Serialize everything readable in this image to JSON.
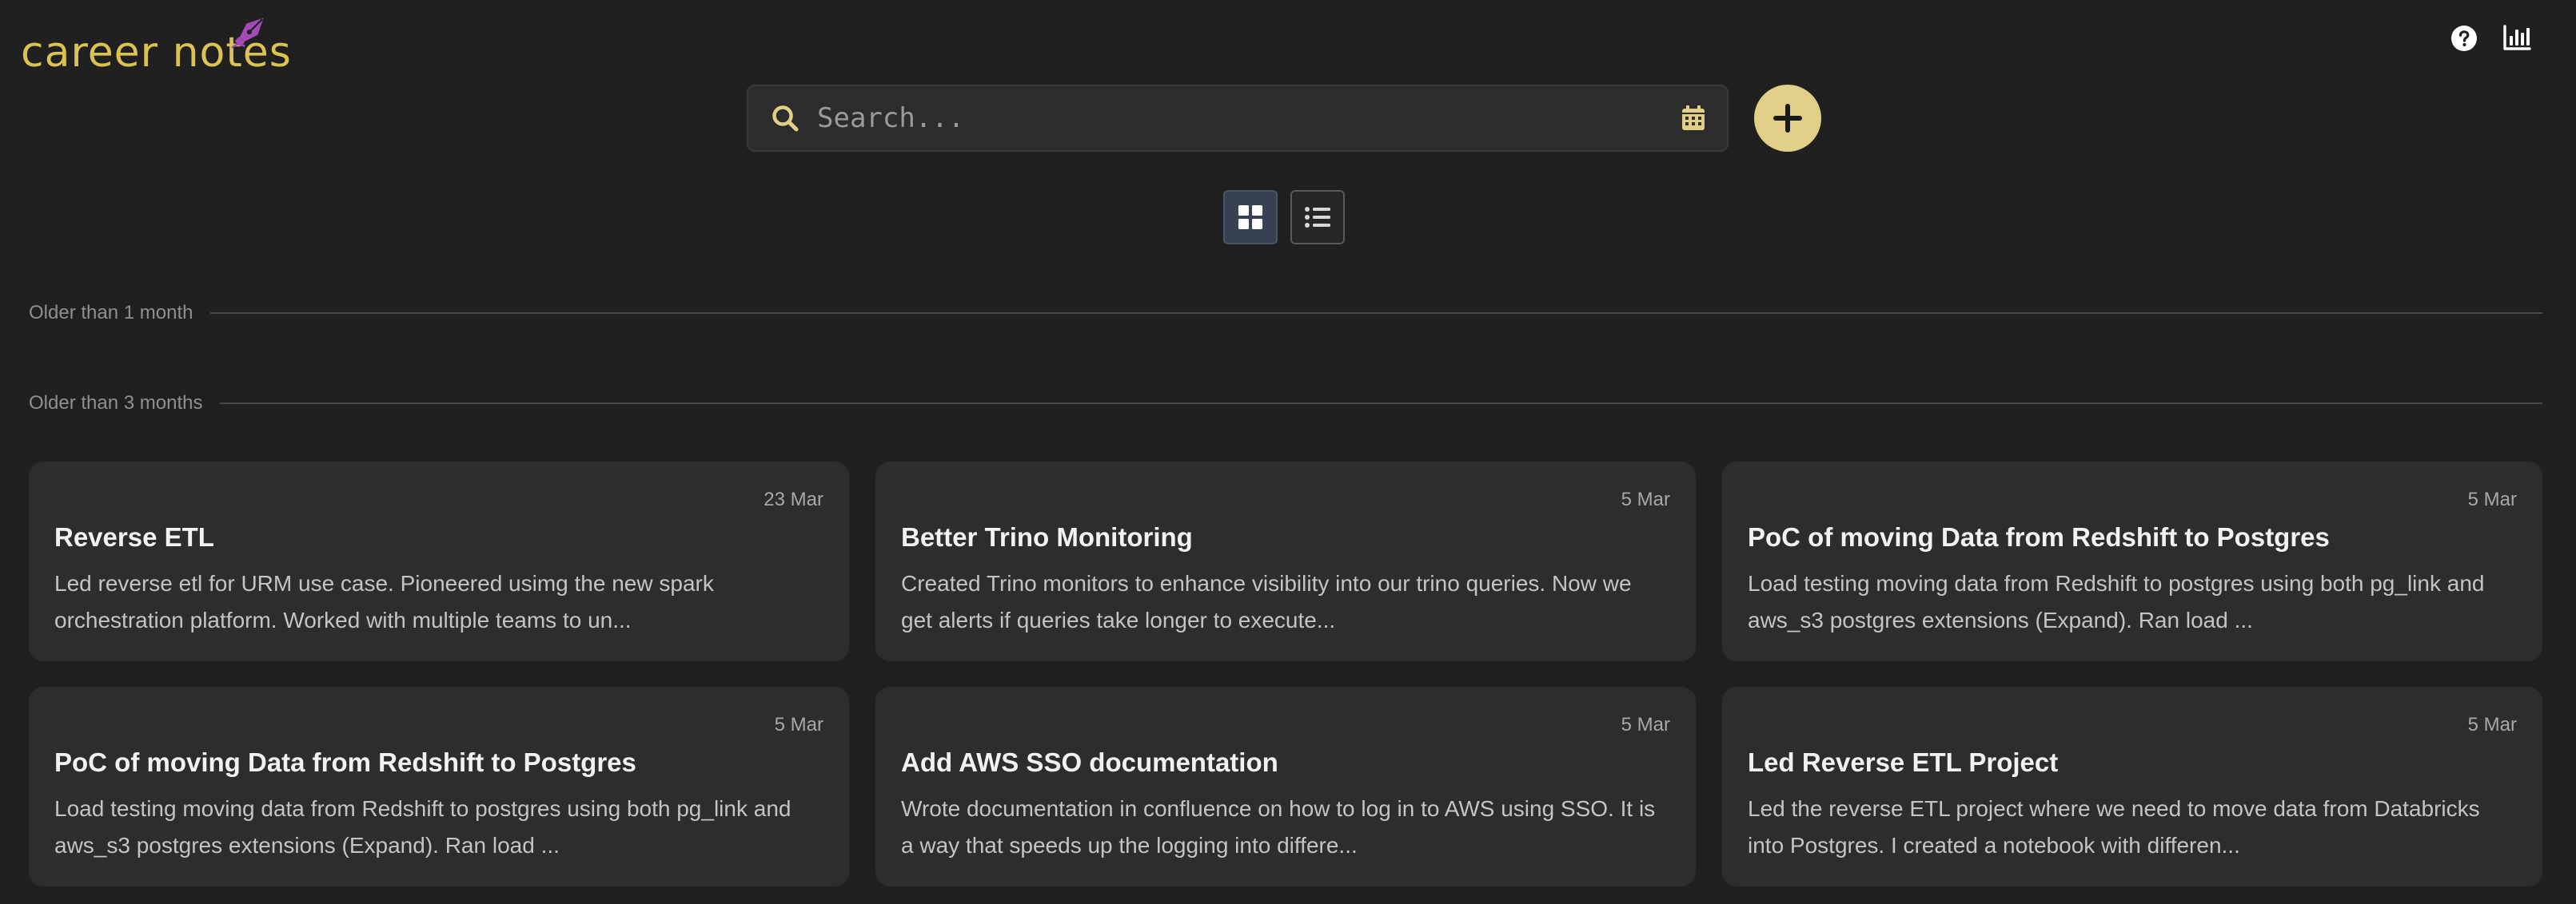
{
  "app": {
    "logo_text": "career notes",
    "accent_color": "#dcc253",
    "pen_color": "#a24bb5"
  },
  "header": {
    "icons": [
      "help-icon",
      "chart-bar-icon"
    ]
  },
  "search": {
    "placeholder": "Search...",
    "value": ""
  },
  "add_button": {
    "icon": "plus-icon",
    "color": "#e2cf87"
  },
  "view": {
    "selected": "grid",
    "options": [
      "grid",
      "list"
    ]
  },
  "sections": [
    {
      "label": "Older than 1 month",
      "notes": []
    },
    {
      "label": "Older than 3 months",
      "notes": [
        {
          "date": "23 Mar",
          "title": "Reverse ETL",
          "body": "Led reverse etl for URM use case. Pioneered usimg the new spark orchestration platform. Worked with multiple teams to un..."
        },
        {
          "date": "5 Mar",
          "title": "Better Trino Monitoring",
          "body": "Created Trino monitors to enhance visibility into our trino queries. Now we get alerts if queries take longer to execute..."
        },
        {
          "date": "5 Mar",
          "title": "PoC of moving Data from Redshift to Postgres",
          "body": "Load testing moving data from Redshift to postgres using both pg_link and aws_s3 postgres extensions (Expand). Ran load ..."
        },
        {
          "date": "5 Mar",
          "title": "PoC of moving Data from Redshift to Postgres",
          "body": "Load testing moving data from Redshift to postgres using both pg_link and aws_s3 postgres extensions (Expand). Ran load ..."
        },
        {
          "date": "5 Mar",
          "title": "Add AWS SSO documentation",
          "body": "Wrote documentation in confluence on how to log in to AWS using SSO. It is a way that speeds up the logging into differe..."
        },
        {
          "date": "5 Mar",
          "title": "Led Reverse ETL Project",
          "body": "Led the reverse ETL project where we need to move data from Databricks into Postgres. I created a notebook with differen..."
        }
      ]
    }
  ]
}
